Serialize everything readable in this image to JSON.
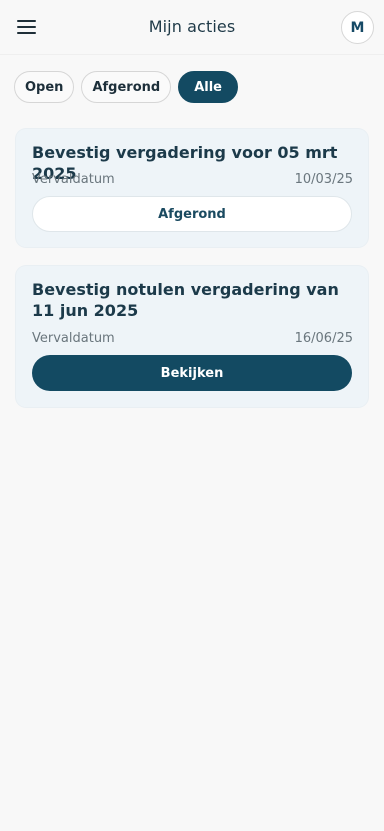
{
  "header": {
    "title": "Mijn acties",
    "menu_icon": "hamburger-menu-icon",
    "avatar_initial": "M"
  },
  "filters": [
    {
      "label": "Open",
      "active": false
    },
    {
      "label": "Afgerond",
      "active": false
    },
    {
      "label": "Alle",
      "active": true
    }
  ],
  "actions": [
    {
      "title": "Bevestig vergadering voor 05 mrt 2025",
      "due_label": "Vervaldatum",
      "due_date": "10/03/25",
      "button_label": "Afgerond",
      "button_style": "outline"
    },
    {
      "title": "Bevestig notulen vergadering van 11 jun 2025",
      "due_label": "Vervaldatum",
      "due_date": "16/06/25",
      "button_label": "Bekijken",
      "button_style": "primary"
    }
  ],
  "colors": {
    "primary": "#134a62",
    "card_background": "#eef4f8",
    "page_background": "#f8f8f8",
    "text_dark": "#1c3a4a",
    "text_muted": "#6a767d"
  }
}
